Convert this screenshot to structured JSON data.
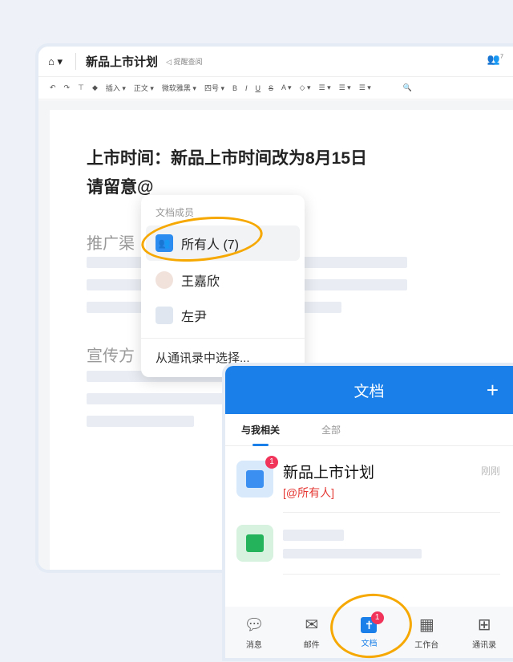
{
  "editor": {
    "title": "新品上市计划",
    "remind": "提醒查阅",
    "member_count": "7",
    "toolbar": [
      "插入 ▾",
      "正文 ▾",
      "微软雅黑 ▾",
      "四号 ▾",
      "B",
      "I",
      "U",
      "S",
      "A ▾",
      "◇ ▾",
      "☰ ▾",
      "☰ ▾",
      "☰ ▾"
    ],
    "line1": "上市时间：新品上市时间改为8月15日",
    "line2": "请留意@",
    "heading2": "推广渠",
    "heading3": "宣传方"
  },
  "mention_popup": {
    "label": "文档成员",
    "items": [
      {
        "name": "所有人 (7)"
      },
      {
        "name": "王嘉欣"
      },
      {
        "name": "左尹"
      }
    ],
    "more": "从通讯录中选择..."
  },
  "mobile": {
    "title": "文档",
    "tabs": [
      "与我相关",
      "全部"
    ],
    "docs": [
      {
        "title": "新品上市计划",
        "mention": "[@所有人]",
        "time": "刚刚",
        "badge": "1"
      }
    ],
    "nav": [
      {
        "label": "消息"
      },
      {
        "label": "邮件"
      },
      {
        "label": "文档",
        "badge": "1"
      },
      {
        "label": "工作台"
      },
      {
        "label": "通讯录"
      }
    ]
  },
  "colors": {
    "accent": "#1a7fe8",
    "highlight": "#f6a800",
    "badge": "#f0345a"
  }
}
